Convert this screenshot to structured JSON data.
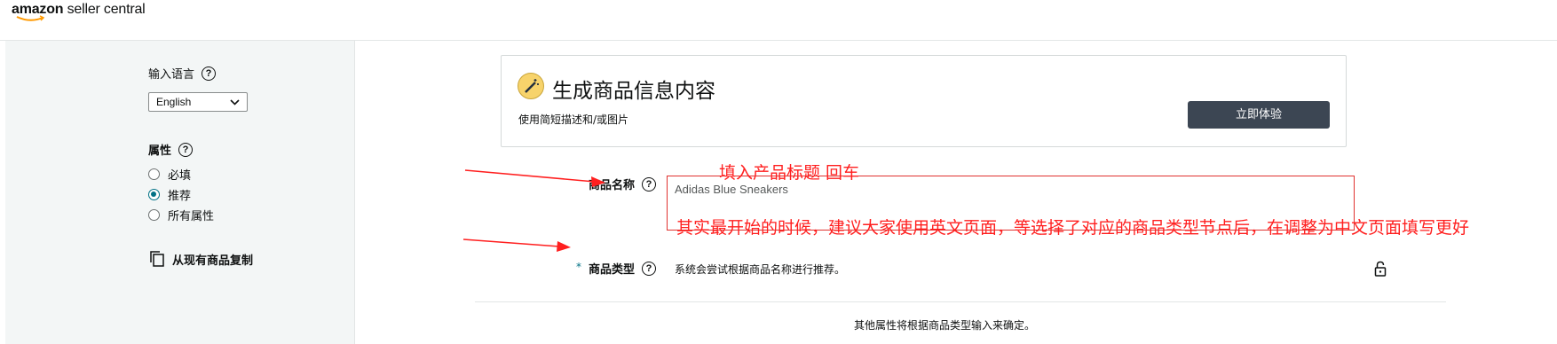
{
  "header": {
    "logo_brand": "amazon",
    "logo_product": "seller central"
  },
  "sidebar": {
    "input_language_label": "输入语言",
    "language_select_value": "English",
    "attributes_label": "属性",
    "attribute_options": [
      "必填",
      "推荐",
      "所有属性"
    ],
    "selected_attribute": "推荐",
    "copy_link_label": "从现有商品复制"
  },
  "card": {
    "title": "生成商品信息内容",
    "subtitle": "使用简短描述和/或图片",
    "button_label": "立即体验"
  },
  "form": {
    "name_label": "商品名称",
    "name_value": "Adidas Blue Sneakers",
    "required_mark": "*",
    "type_label": "商品类型",
    "type_hint": "系统会尝试根据商品名称进行推荐。",
    "footer_note": "其他属性将根据商品类型输入来确定。"
  },
  "annotations": {
    "note_1": "填入产品标题 回车",
    "note_2": "其实最开始的时候，建议大家使用英文页面，等选择了对应的商品类型节点后，在调整为中文页面填写更好"
  },
  "colors": {
    "accent": "#007185",
    "annotation": "#ff1f1f",
    "button_bg": "#3c4653",
    "sidebar_bg": "#f3f6f6"
  },
  "icons": [
    "smile-logo",
    "help-icon",
    "chevron-down-icon",
    "copy-icon",
    "magic-wand-icon",
    "lock-icon",
    "arrow"
  ]
}
